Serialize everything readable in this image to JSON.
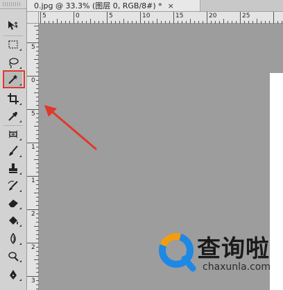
{
  "document": {
    "tab_title": "0.jpg @ 33.3% (图层 0, RGB/8#) *",
    "close_glyph": "×"
  },
  "rulers": {
    "horizontal": [
      "5",
      "0",
      "5",
      "10",
      "15",
      "20",
      "25"
    ],
    "vertical": [
      "5",
      "0",
      "5",
      "1",
      "1",
      "2",
      "2",
      "3"
    ]
  },
  "tools": [
    {
      "name": "move-tool",
      "icon": "move-icon"
    },
    {
      "name": "marquee-tool",
      "icon": "marquee-icon"
    },
    {
      "name": "lasso-tool",
      "icon": "lasso-icon"
    },
    {
      "name": "magic-wand-tool",
      "icon": "magic-wand-icon",
      "active": true
    },
    {
      "name": "crop-tool",
      "icon": "crop-icon"
    },
    {
      "name": "eyedropper-tool",
      "icon": "eyedropper-icon"
    },
    {
      "name": "healing-brush-tool",
      "icon": "healing-icon"
    },
    {
      "name": "brush-tool",
      "icon": "brush-icon"
    },
    {
      "name": "clone-stamp-tool",
      "icon": "stamp-icon"
    },
    {
      "name": "history-brush-tool",
      "icon": "history-brush-icon"
    },
    {
      "name": "eraser-tool",
      "icon": "eraser-icon"
    },
    {
      "name": "paint-bucket-tool",
      "icon": "bucket-icon"
    },
    {
      "name": "blur-tool",
      "icon": "blur-icon"
    },
    {
      "name": "dodge-tool",
      "icon": "dodge-icon"
    },
    {
      "name": "pen-tool",
      "icon": "pen-icon"
    }
  ],
  "annotation": {
    "color": "#e0382b"
  },
  "watermark": {
    "brand_text": "查询啦",
    "domain_text": "chaxunla.com",
    "logo_colors": [
      "#1e88e5",
      "#f39c12"
    ]
  }
}
